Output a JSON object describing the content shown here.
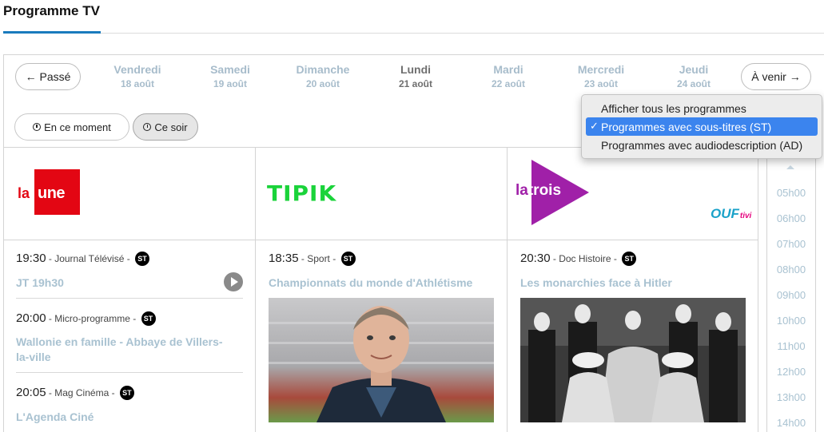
{
  "header": {
    "title": "Programme TV"
  },
  "nav": {
    "prev_label": "← Passé",
    "next_label": "À venir →"
  },
  "days": [
    {
      "name": "Vendredi",
      "date": "18 août"
    },
    {
      "name": "Samedi",
      "date": "19 août"
    },
    {
      "name": "Dimanche",
      "date": "20 août"
    },
    {
      "name": "Lundi",
      "date": "21 août",
      "active": true
    },
    {
      "name": "Mardi",
      "date": "22 août"
    },
    {
      "name": "Mercredi",
      "date": "23 août"
    },
    {
      "name": "Jeudi",
      "date": "24 août"
    }
  ],
  "filters": {
    "now_label": "En ce moment",
    "tonight_label": "Ce soir"
  },
  "dropdown": {
    "options": [
      "Afficher tous les programmes",
      "Programmes avec sous-titres (ST)",
      "Programmes avec audiodescription (AD)"
    ],
    "selected_index": 1,
    "check_mark": "✓"
  },
  "channels": {
    "une": {
      "logo_la": "la",
      "logo_name": "une",
      "programs": [
        {
          "time": "19:30",
          "category": " - Journal Télévisé - ",
          "badge": "ST",
          "title": "JT 19h30"
        },
        {
          "time": "20:00",
          "category": " - Micro-programme - ",
          "badge": "ST",
          "title": "Wallonie en famille - Abbaye de Villers-la-ville"
        },
        {
          "time": "20:05",
          "category": " - Mag Cinéma - ",
          "badge": "ST",
          "title": "L'Agenda Ciné"
        }
      ]
    },
    "tipik": {
      "logo_name": "TIPIK",
      "programs": [
        {
          "time": "18:35",
          "category": " - Sport - ",
          "badge": "ST",
          "title": "Championnats du monde d'Athlétisme"
        }
      ]
    },
    "trois": {
      "logo_la": "la",
      "logo_name": "trois",
      "sub_logo": "OUF",
      "sub_logo_suffix": "tivi",
      "programs": [
        {
          "time": "20:30",
          "category": " - Doc Histoire - ",
          "badge": "ST",
          "title": "Les monarchies face à Hitler"
        }
      ]
    }
  },
  "timeline": {
    "hours": [
      "05h00",
      "06h00",
      "07h00",
      "08h00",
      "09h00",
      "10h00",
      "11h00",
      "12h00",
      "13h00",
      "14h00"
    ]
  }
}
